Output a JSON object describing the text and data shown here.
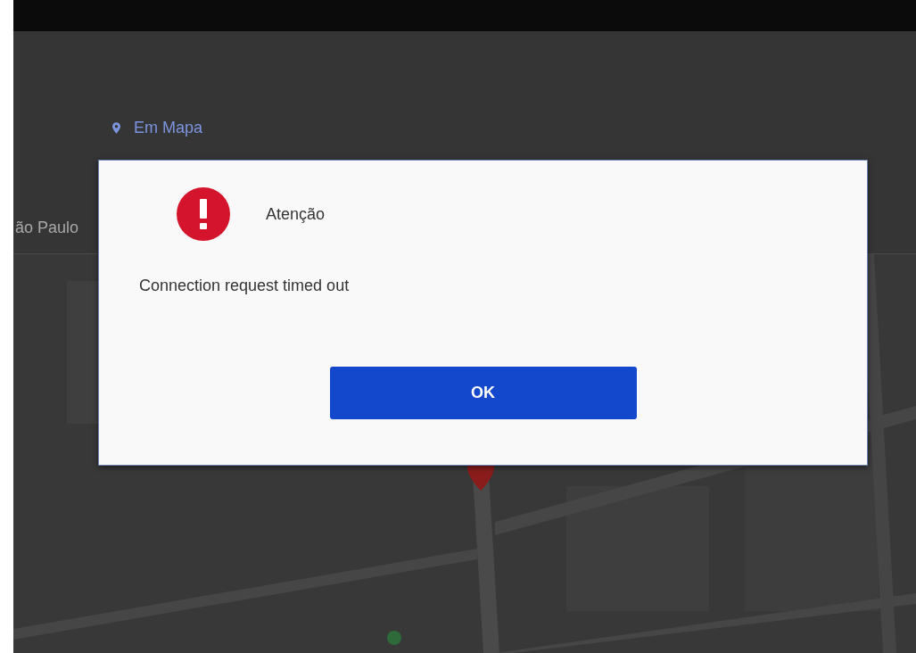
{
  "header": {
    "map_link": "Em Mapa",
    "location": "ão Paulo"
  },
  "dialog": {
    "title": "Atenção",
    "message": "Connection request timed out",
    "button": "OK"
  }
}
